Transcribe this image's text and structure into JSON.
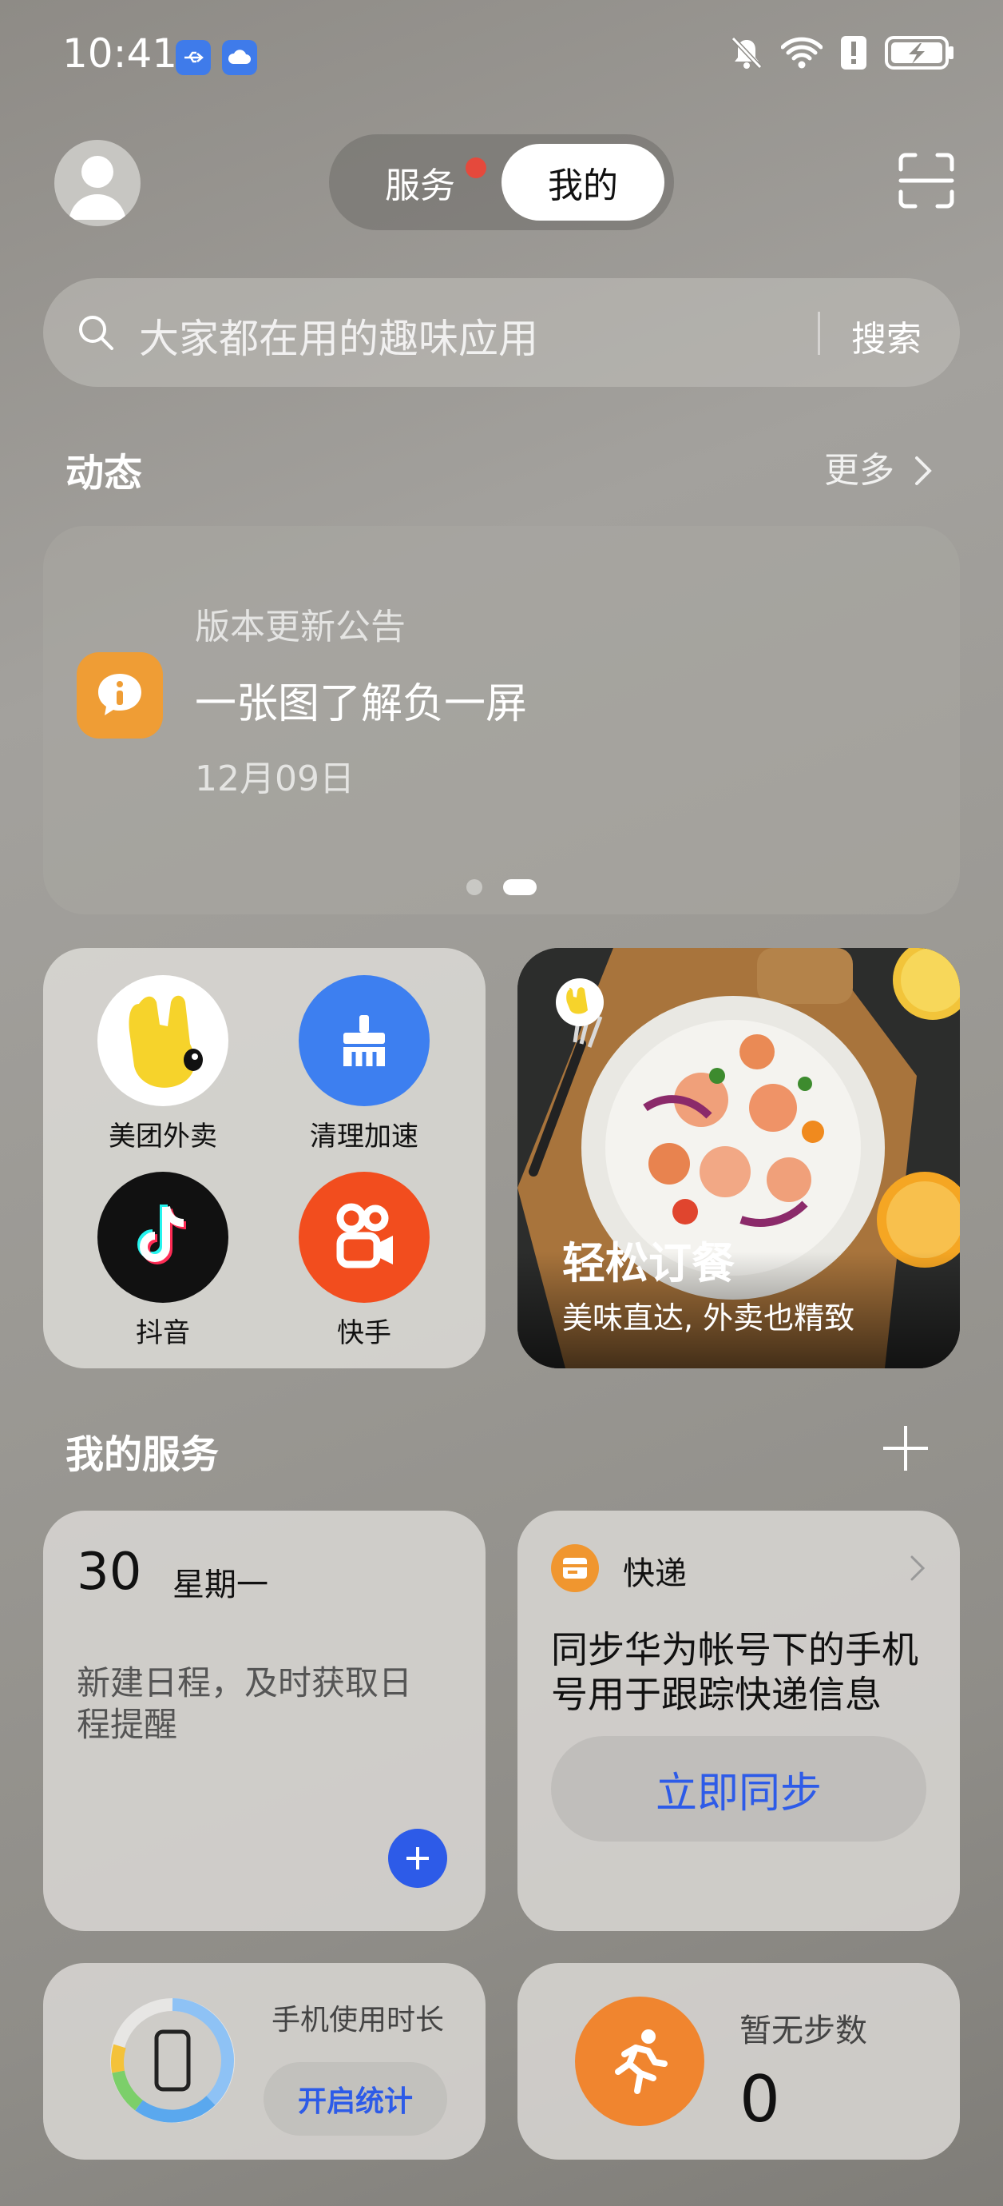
{
  "status_bar": {
    "time": "10:41",
    "icons": [
      "usb-icon",
      "cloud-icon",
      "mute-icon",
      "wifi-icon",
      "alert-icon",
      "battery-charging-icon"
    ]
  },
  "header": {
    "tab_service": "服务",
    "tab_mine": "我的",
    "active_tab": "我的"
  },
  "search": {
    "placeholder": "大家都在用的趣味应用",
    "button": "搜索"
  },
  "dynamics": {
    "title": "动态",
    "more": "更多",
    "card": {
      "tag": "版本更新公告",
      "title": "一张图了解负一屏",
      "date": "12月09日"
    },
    "page_count": 2,
    "active_page": 2
  },
  "apps": [
    {
      "label": "美团外卖",
      "icon": "meituan-icon"
    },
    {
      "label": "清理加速",
      "icon": "broom-icon"
    },
    {
      "label": "抖音",
      "icon": "douyin-icon"
    },
    {
      "label": "快手",
      "icon": "kuaishou-icon"
    }
  ],
  "promo": {
    "title": "轻松订餐",
    "subtitle": "美味直达, 外卖也精致"
  },
  "services": {
    "title": "我的服务",
    "calendar": {
      "day": "30",
      "weekday": "星期一",
      "desc": "新建日程，及时获取日程提醒"
    },
    "express": {
      "title": "快递",
      "desc": "同步华为帐号下的手机号用于跟踪快递信息",
      "button": "立即同步"
    },
    "usage": {
      "title": "手机使用时长",
      "button": "开启统计"
    },
    "steps": {
      "title": "暂无步数",
      "value": "0"
    }
  },
  "colors": {
    "accent_blue": "#2d5be8",
    "orange": "#f0962f",
    "badge_red": "#e5493c"
  }
}
